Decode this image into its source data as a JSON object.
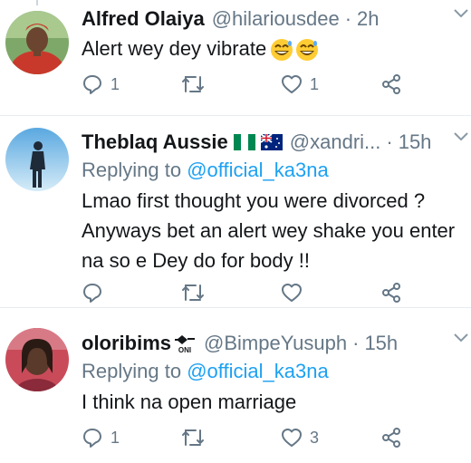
{
  "tweets": [
    {
      "name": "Alfred Olaiya",
      "handle": "@hilariousdee",
      "separator": "·",
      "time": "2h",
      "text": "Alert wey dey vibrate",
      "emoji": "grinning-sweat-emoji",
      "actions": {
        "reply_count": "1",
        "retweet_count": "",
        "like_count": "1"
      }
    },
    {
      "name": "Theblaq Aussie",
      "handle": "@xandri...",
      "separator": "·",
      "time": "15h",
      "replying_prefix": "Replying to",
      "replying_to": "@official_ka3na",
      "text_lines": [
        "Lmao first thought you were divorced ?",
        "Anyways bet an alert wey shake you enter",
        "na so e Dey do for body !!"
      ],
      "actions": {
        "reply_count": "",
        "retweet_count": "",
        "like_count": ""
      }
    },
    {
      "name": "oloribims",
      "badge_text": "ONI",
      "handle": "@BimpeYusuph",
      "separator": "·",
      "time": "15h",
      "replying_prefix": "Replying to",
      "replying_to": "@official_ka3na",
      "text": "I think na open marriage",
      "actions": {
        "reply_count": "1",
        "retweet_count": "",
        "like_count": "3"
      }
    }
  ],
  "icons": [
    "reply-icon",
    "retweet-icon",
    "like-icon",
    "share-icon",
    "chevron-down-icon",
    "nigeria-flag-icon",
    "australia-flag-icon",
    "oni-badge-icon"
  ],
  "colors": {
    "name": "#14171a",
    "secondary": "#657786",
    "mention": "#1da1f2",
    "divider": "#e6ecf0"
  }
}
